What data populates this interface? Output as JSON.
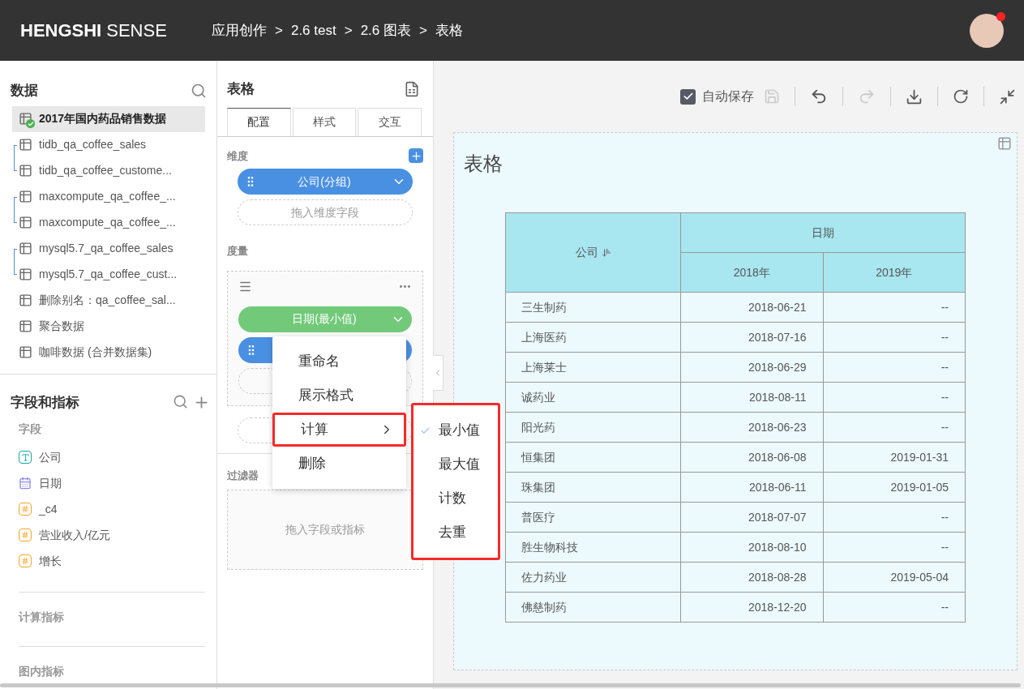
{
  "header": {
    "logo_bold": "HENGSHI",
    "logo_light": "SENSE",
    "breadcrumb": [
      {
        "label": "应用创作"
      },
      {
        "sep": ">",
        "label": "2.6 test"
      },
      {
        "sep": ">",
        "label": "2.6 图表"
      },
      {
        "sep": ">",
        "label": "表格"
      }
    ],
    "notification": true
  },
  "data_panel": {
    "title": "数据",
    "datasets": [
      {
        "name": "2017年国内药品销售数据",
        "selected": true,
        "connected": true,
        "kind": "plain"
      },
      {
        "name": "tidb_qa_coffee_sales",
        "selected": false,
        "connected": false,
        "kind": "pair_start"
      },
      {
        "name": "tidb_qa_coffee_custome...",
        "selected": false,
        "connected": false,
        "kind": "pair_end"
      },
      {
        "name": "maxcompute_qa_coffee_...",
        "selected": false,
        "connected": false,
        "kind": "pair_start"
      },
      {
        "name": "maxcompute_qa_coffee_...",
        "selected": false,
        "connected": false,
        "kind": "pair_end"
      },
      {
        "name": "mysql5.7_qa_coffee_sales",
        "selected": false,
        "connected": false,
        "kind": "pair_start"
      },
      {
        "name": "mysql5.7_qa_coffee_cust...",
        "selected": false,
        "connected": false,
        "kind": "pair_end"
      },
      {
        "name": "删除别名：qa_coffee_sal...",
        "selected": false,
        "connected": false,
        "kind": "plain"
      },
      {
        "name": "聚合数据",
        "selected": false,
        "connected": false,
        "kind": "plain"
      },
      {
        "name": "咖啡数据 (合并数据集)",
        "selected": false,
        "connected": false,
        "kind": "plain"
      }
    ]
  },
  "fields_panel": {
    "title": "字段和指标",
    "section": "字段",
    "fields": [
      {
        "kind": "text",
        "name": "公司"
      },
      {
        "kind": "date",
        "name": "日期"
      },
      {
        "kind": "number",
        "name": "_c4"
      },
      {
        "kind": "number",
        "name": "营业收入/亿元"
      },
      {
        "kind": "number",
        "name": "增长"
      }
    ],
    "groups": [
      "计算指标",
      "图内指标"
    ]
  },
  "config": {
    "title": "表格",
    "tabs": [
      {
        "label": "配置",
        "selected": true
      },
      {
        "label": "样式",
        "selected": false
      },
      {
        "label": "交互",
        "selected": false
      }
    ],
    "dimension_label": "维度",
    "dimension_pill": "公司(分组)",
    "dimension_drop": "拖入维度字段",
    "measure_label": "度量",
    "measure_pill": "日期(最小值)",
    "filter_label": "过滤器",
    "filter_drop": "拖入字段或指标"
  },
  "context_menu": [
    {
      "label": "重命名",
      "highlighted": false,
      "has_submenu": false
    },
    {
      "label": "展示格式",
      "highlighted": false,
      "has_submenu": false
    },
    {
      "label": "计算",
      "highlighted": true,
      "has_submenu": true
    },
    {
      "label": "删除",
      "highlighted": false,
      "has_submenu": false
    }
  ],
  "submenu": [
    {
      "label": "最小值",
      "checked": true
    },
    {
      "label": "最大值",
      "checked": false
    },
    {
      "label": "计数",
      "checked": false
    },
    {
      "label": "去重",
      "checked": false
    }
  ],
  "toolbar": {
    "autosave_label": "自动保存",
    "autosave_checked": true,
    "save_disabled": true,
    "redo_disabled": true
  },
  "chart": {
    "title": "表格",
    "row_header": "公司",
    "col_header": "日期",
    "sub_headers": [
      "2018年",
      "2019年"
    ],
    "rows": [
      [
        "三生制药",
        "2018-06-21",
        "--"
      ],
      [
        "上海医药",
        "2018-07-16",
        "--"
      ],
      [
        "上海莱士",
        "2018-06-29",
        "--"
      ],
      [
        "诚药业",
        "2018-08-11",
        "--"
      ],
      [
        "阳光药",
        "2018-06-23",
        "--"
      ],
      [
        "恒集团",
        "2018-06-08",
        "2019-01-31"
      ],
      [
        "珠集团",
        "2018-06-11",
        "2019-01-05"
      ],
      [
        "普医疗",
        "2018-07-07",
        "--"
      ],
      [
        "胜生物科技",
        "2018-08-10",
        "--"
      ],
      [
        "佐力药业",
        "2018-08-28",
        "2019-05-04"
      ],
      [
        "佛慈制药",
        "2018-12-20",
        "--"
      ]
    ]
  }
}
